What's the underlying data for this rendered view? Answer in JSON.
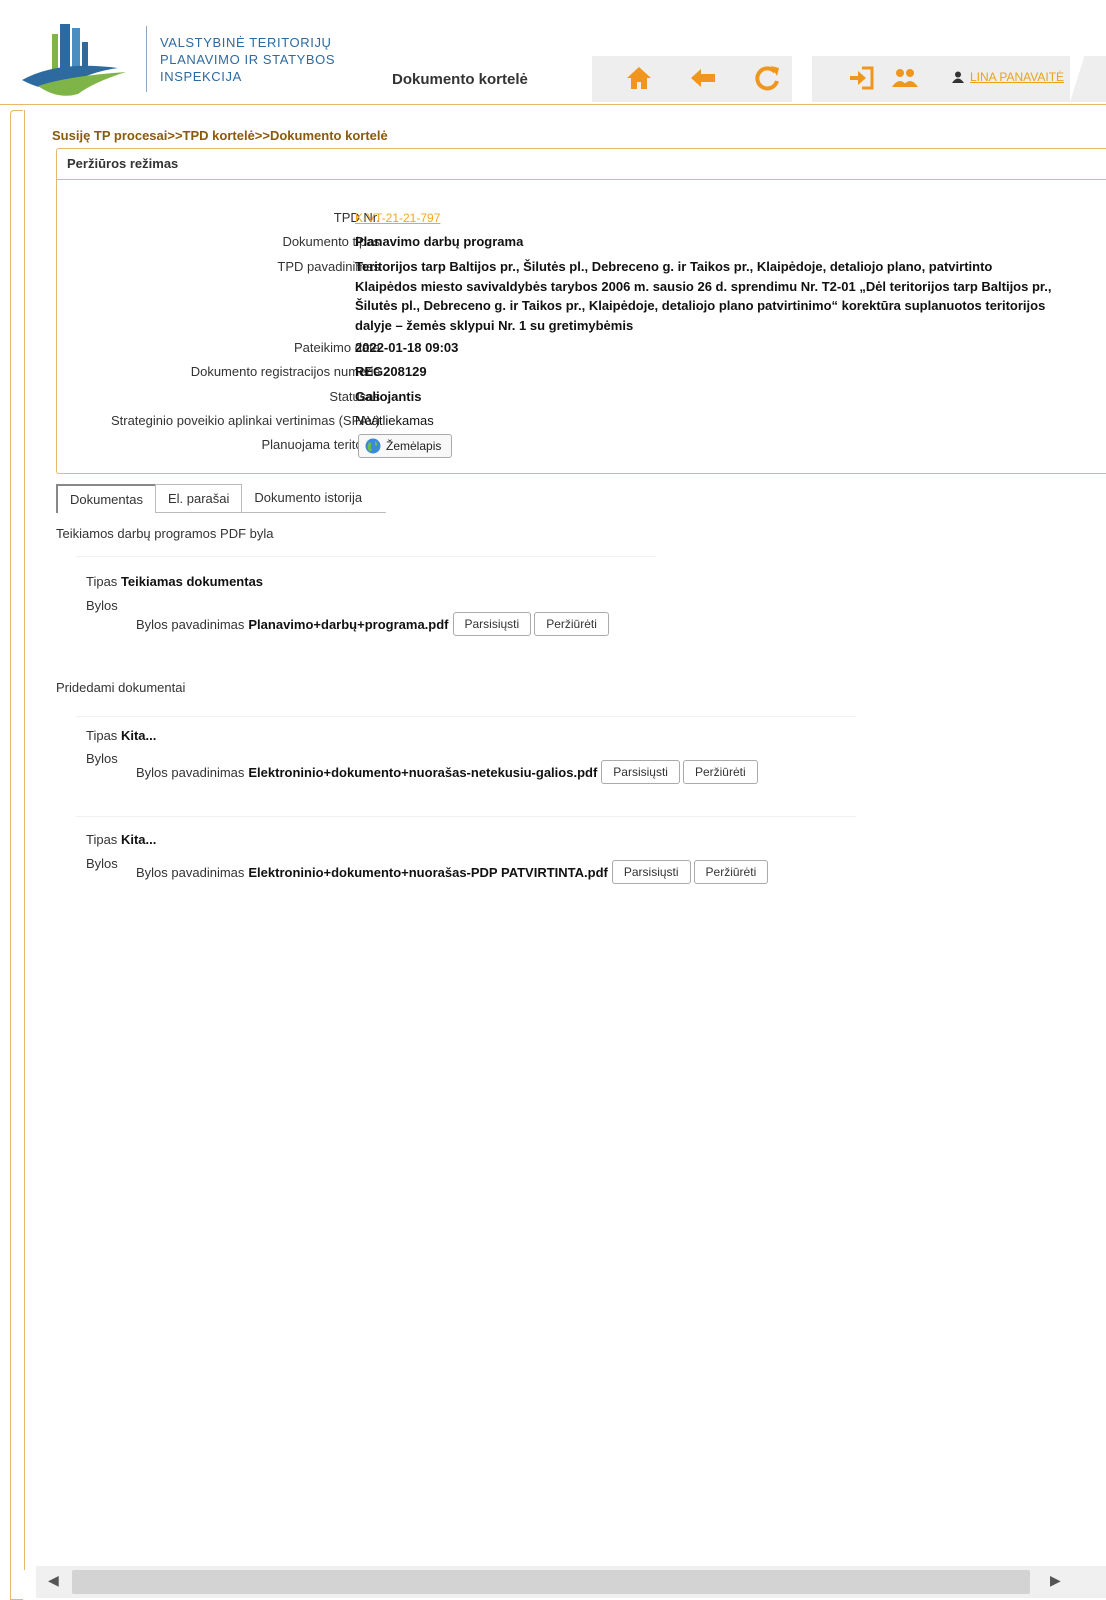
{
  "header": {
    "org_lines": [
      "VALSTYBINĖ TERITORIJŲ",
      "PLANAVIMO IR STATYBOS",
      "INSPEKCIJA"
    ],
    "page_title": "Dokumento kortelė",
    "user_name": "LINA PANAVAITĖ",
    "accent_color": "#f0961e",
    "icons": [
      "home-icon",
      "back-arrow-icon",
      "refresh-icon",
      "logout-icon",
      "users-icon",
      "user-icon"
    ]
  },
  "breadcrumb": "Susiję TP procesai>>TPD kortelė>>Dokumento kortelė",
  "panel": {
    "title": "Peržiūros režimas",
    "fields": {
      "tpd_nr_label": "TPD Nr.",
      "tpd_nr_value": "K-VT-21-21-797",
      "doc_type_label": "Dokumento tipas",
      "doc_type_value": "Planavimo darbų programa",
      "tpd_name_label": "TPD pavadinimas",
      "tpd_name_lines": [
        "Teritorijos tarp Baltijos pr., Šilutės pl., Debreceno g. ir Taikos pr., Klaipėdoje, detaliojo plano, patvirtinto",
        "Klaipėdos miesto savivaldybės tarybos 2006 m. sausio 26 d. sprendimu Nr. T2-01 „Dėl teritorijos tarp Baltijos pr.,",
        "Šilutės pl., Debreceno g. ir Taikos pr., Klaipėdoje, detaliojo plano patvirtinimo“ korektūra suplanuotos teritorijos",
        "dalyje – žemės sklypui Nr. 1 su gretimybėmis"
      ],
      "submit_date_label": "Pateikimo data",
      "submit_date_value": "2022-01-18 09:03",
      "reg_no_label": "Dokumento registracijos numeris",
      "reg_no_value": "REG208129",
      "status_label": "Statusas",
      "status_value": "Galiojantis",
      "spav_label": "Strateginio poveikio aplinkai vertinimas (SPAV)",
      "spav_value": "Neatliekamas",
      "territory_label": "Planuojama teritorija",
      "map_button": "Žemėlapis"
    }
  },
  "tabs": [
    "Dokumentas",
    "El. parašai",
    "Dokumento istorija"
  ],
  "sections": {
    "submitted_title": "Teikiamos darbų programos PDF byla",
    "attached_title": "Pridedami dokumentai"
  },
  "labels": {
    "type": "Tipas",
    "files": "Bylos",
    "file_name": "Bylos pavadinimas",
    "download": "Parsisiųsti",
    "view": "Peržiūrėti"
  },
  "documents": [
    {
      "type": "Teikiamas dokumentas",
      "file": "Planavimo+darbų+programa.pdf"
    },
    {
      "type": "Kita...",
      "file": "Elektroninio+dokumento+nuorašas-netekusiu-galios.pdf"
    },
    {
      "type": "Kita...",
      "file": "Elektroninio+dokumento+nuorašas-PDP PATVIRTINTA.pdf"
    }
  ]
}
